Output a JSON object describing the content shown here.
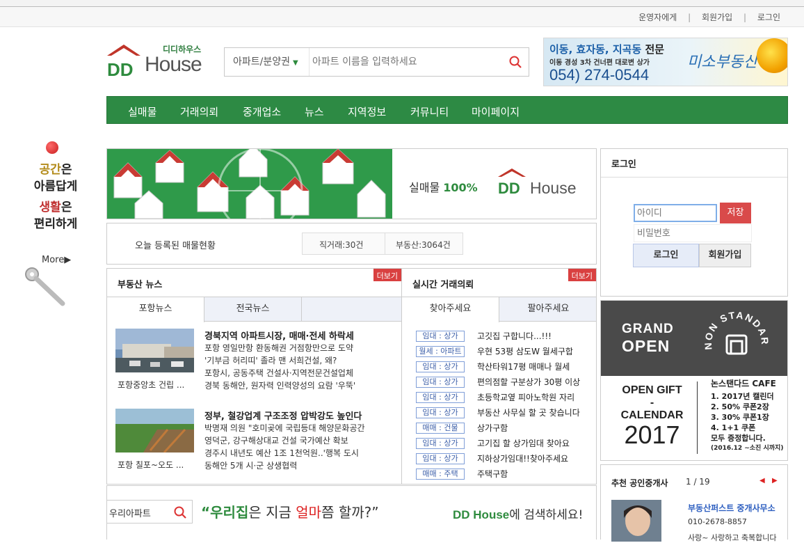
{
  "topbar": {
    "links": [
      "운영자에게",
      "회원가입",
      "로그인"
    ],
    "separator": "|"
  },
  "logo": {
    "sub": "디디하우스",
    "main": "House",
    "mark": "DD"
  },
  "search": {
    "category": "아파트/분양권",
    "placeholder": "아파트 이름을 입력하세요"
  },
  "ad": {
    "line1_blue": "이동, 효자동, 지곡동",
    "line1_black": "전문",
    "line2": "이동 경성 3차 건너편 대로변 상가",
    "phone": "054) 274-0544",
    "brand": "미소부동산"
  },
  "nav": {
    "items": [
      "실매물",
      "거래의뢰",
      "중개업소",
      "뉴스",
      "지역정보",
      "커뮤니티",
      "마이페이지"
    ]
  },
  "side": {
    "line1_hl": "공간",
    "line1_rest": "은",
    "line2": "아름답게",
    "line3_hl": "생활",
    "line3_rest": "은",
    "line4": "편리하게",
    "more": "More▶"
  },
  "hero": {
    "text_prefix": "실매물",
    "text_bold": "100%",
    "logo_mark": "DD",
    "logo_word": "House"
  },
  "today": {
    "label": "오늘 등록된 매물현황",
    "direct": "직거래:30건",
    "agency": "부동산:3064건"
  },
  "news": {
    "title": "부동산 뉴스",
    "more": "더보기",
    "tabs": [
      "포항뉴스",
      "전국뉴스"
    ],
    "items": [
      {
        "caption": "포항중앙초 건립 ...",
        "headline": "경북지역 아파트시장, 매매·전세 하락세",
        "lines": [
          "포항 영일만항 환동해권 거점항만으로 도약",
          "'기부금 허리띠' 졸라 맨 서희건설, 왜?",
          "포항시, 공동주택 건설사·지역전문건설업체",
          "경북 동해안, 원자력 인력양성의 요람 '우뚝'"
        ]
      },
      {
        "caption": "포항 칠포~오도 ...",
        "headline": "정부, 철강업계 구조조정 압박강도 높인다",
        "lines": [
          "박명재 의원 \"호미곶에 국립등대 해양문화공간",
          "영덕군, 강구해상대교 건설 국가예산 확보",
          "경주시 내년도 예산 1조 1천억원..'행복 도시",
          "동해안 5개 시·군 상생협력"
        ]
      }
    ]
  },
  "deal": {
    "title": "실시간 거래의뢰",
    "more": "더보기",
    "tabs": [
      "찾아주세요",
      "팔아주세요"
    ],
    "rows": [
      {
        "tag": "임대 : 상가",
        "text": "고깃집 구합니다...!!!"
      },
      {
        "tag": "월세 : 아파트",
        "text": "우현 53평 삼도W 월세구합"
      },
      {
        "tag": "임대 : 상가",
        "text": "학산타워17평 매매나 월세"
      },
      {
        "tag": "임대 : 상가",
        "text": "편의점할 구분상가 30평 이상"
      },
      {
        "tag": "임대 : 상가",
        "text": "초등학교옆 피아노학원 자리"
      },
      {
        "tag": "임대 : 상가",
        "text": "부동산 사무실 할 곳 찾습니다"
      },
      {
        "tag": "매매 : 건물",
        "text": "상가구함"
      },
      {
        "tag": "임대 : 상가",
        "text": "고기집 할 상가임대 찾아요"
      },
      {
        "tag": "임대 : 상가",
        "text": "지하상가임대!!찾아주세요"
      },
      {
        "tag": "매매 : 주택",
        "text": "주택구함"
      }
    ]
  },
  "bottom": {
    "search_value": "우리아파트",
    "quote_open": "“",
    "quote_green": "우리집",
    "quote_mid": "은 지금 ",
    "quote_red": "얼마",
    "quote_end": "쯤 할까?",
    "quote_close": "”",
    "right_logo": "DD House",
    "right_text": "에 검색하세요!"
  },
  "login": {
    "title": "로그인",
    "id_placeholder": "아이디",
    "pw_placeholder": "비밀번호",
    "save": "저장",
    "login_btn": "로그인",
    "join_btn": "회원가입"
  },
  "cafe": {
    "grand": "GRAND",
    "open": "OPEN",
    "brand_ring": "NON STANDARD",
    "gift_l1": "OPEN GIFT",
    "gift_l2": "-",
    "gift_l3": "CALENDAR",
    "gift_year": "2017",
    "r_title": "논스탠다드 CAFE",
    "r_items": [
      "1. 2017년 캘린더",
      "2. 50% 쿠폰2장",
      "3. 30% 쿠폰1장",
      "4. 1+1 쿠폰",
      "모두 증정합니다.",
      "(2016.12 ~소진 시까지)"
    ]
  },
  "agent": {
    "title": "추천 공인중개사",
    "page": "1 / 19",
    "name": "부동산퍼스트 중개사무소",
    "phone": "010-2678-8857",
    "desc": "사랑~ 사랑하고 축복합니다"
  },
  "colors": {
    "brand_green": "#2d8a44",
    "accent_red": "#d94040",
    "tag_blue": "#3b5ea8"
  }
}
